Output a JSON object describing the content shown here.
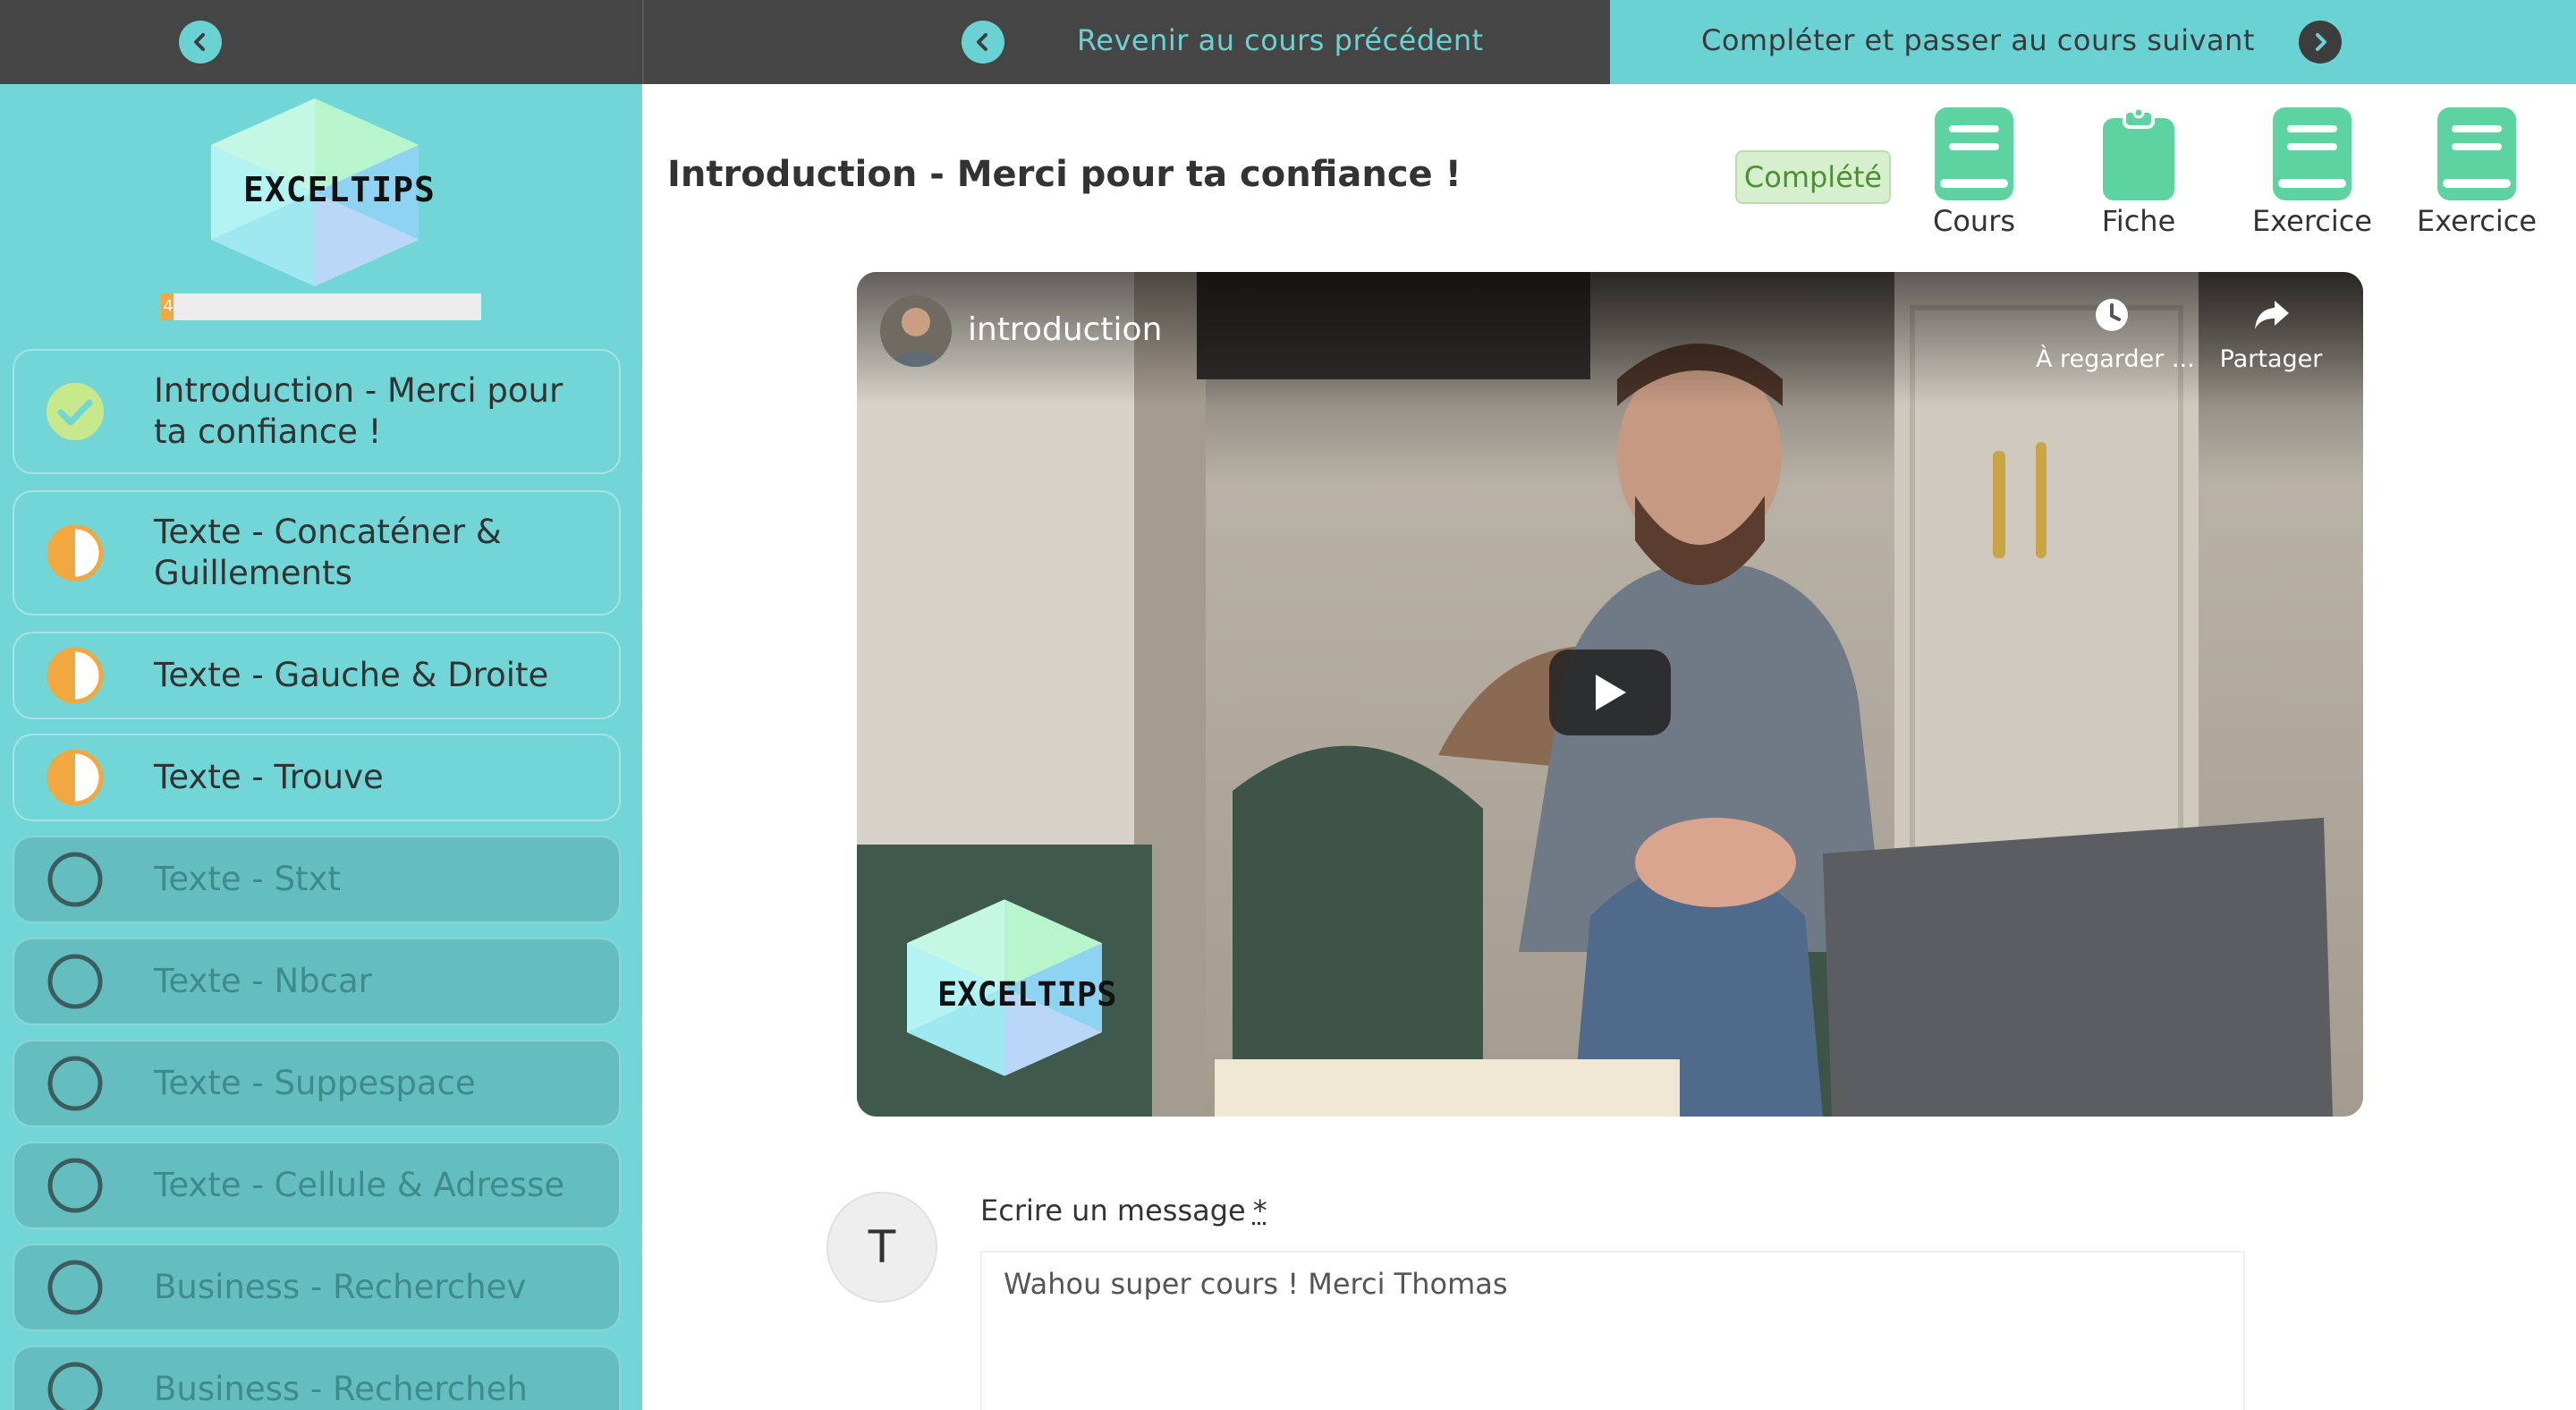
{
  "topbar": {
    "prev_label": "Revenir au cours précédent",
    "next_label": "Compléter et passer au cours suivant"
  },
  "sidebar": {
    "logo_text": "EXCELTIPS",
    "progress": {
      "percent": 4,
      "label": "4"
    },
    "lessons": [
      {
        "title": "Introduction - Merci pour ta confiance !",
        "status": "completed"
      },
      {
        "title": "Texte - Concaténer & Guillements",
        "status": "in-progress"
      },
      {
        "title": "Texte - Gauche & Droite",
        "status": "in-progress"
      },
      {
        "title": "Texte - Trouve",
        "status": "in-progress"
      },
      {
        "title": "Texte - Stxt",
        "status": "not-started"
      },
      {
        "title": "Texte - Nbcar",
        "status": "not-started"
      },
      {
        "title": "Texte - Suppespace",
        "status": "not-started"
      },
      {
        "title": "Texte - Cellule & Adresse",
        "status": "not-started"
      },
      {
        "title": "Business - Recherchev",
        "status": "not-started"
      },
      {
        "title": "Business - Rechercheh",
        "status": "not-started"
      }
    ]
  },
  "main": {
    "title": "Introduction - Merci pour ta confiance !",
    "status_badge": "Complété",
    "resources": [
      {
        "label": "Cours",
        "icon": "book-icon"
      },
      {
        "label": "Fiche",
        "icon": "clipboard-icon"
      },
      {
        "label": "Exercice",
        "icon": "book-icon"
      },
      {
        "label": "Exercice",
        "icon": "book-icon"
      }
    ]
  },
  "video": {
    "title": "introduction",
    "watch_later_label": "À regarder ...",
    "share_label": "Partager",
    "watermark_text": "EXCELTIPS"
  },
  "comment": {
    "avatar_initial": "T",
    "label": "Ecrire un message",
    "required_mark": "*",
    "value": "Wahou super cours ! Merci Thomas"
  },
  "colors": {
    "teal": "#6bd2d3",
    "dark": "#454545",
    "completed_check": "#c7e98c",
    "in_progress": "#f2a840",
    "badge_green": "#4f8f33",
    "resource_green": "#5dd3a2"
  }
}
